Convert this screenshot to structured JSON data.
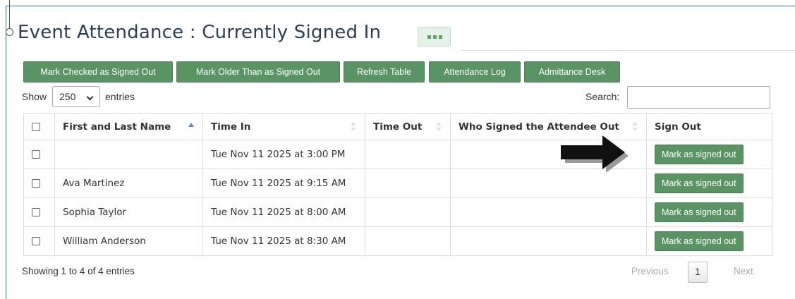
{
  "header": {
    "title": "Event Attendance : Currently Signed In"
  },
  "toolbar": {
    "buttons": [
      {
        "label": "Mark Checked as Signed Out"
      },
      {
        "label": "Mark Older Than as Signed Out"
      },
      {
        "label": "Refresh Table"
      },
      {
        "label": "Attendance Log"
      },
      {
        "label": "Admittance Desk"
      }
    ]
  },
  "length_control": {
    "show_label": "Show",
    "selected_value": "250",
    "entries_label": "entries"
  },
  "search": {
    "label": "Search:",
    "value": ""
  },
  "table": {
    "columns": [
      {
        "label": ""
      },
      {
        "label": "First and Last Name"
      },
      {
        "label": "Time In"
      },
      {
        "label": "Time Out"
      },
      {
        "label": "Who Signed the Attendee Out"
      },
      {
        "label": "Sign Out"
      }
    ],
    "rows": [
      {
        "name": "",
        "time_in": "Tue Nov 11 2025 at 3:00 PM",
        "time_out": "",
        "signed_out_by": "",
        "action": "Mark as signed out"
      },
      {
        "name": "Ava Martinez",
        "time_in": "Tue Nov 11 2025 at 9:15 AM",
        "time_out": "",
        "signed_out_by": "",
        "action": "Mark as signed out"
      },
      {
        "name": "Sophia Taylor",
        "time_in": "Tue Nov 11 2025 at 8:00 AM",
        "time_out": "",
        "signed_out_by": "",
        "action": "Mark as signed out"
      },
      {
        "name": "William Anderson",
        "time_in": "Tue Nov 11 2025 at 8:30 AM",
        "time_out": "",
        "signed_out_by": "",
        "action": "Mark as signed out"
      }
    ]
  },
  "footer": {
    "info": "Showing 1 to 4 of 4 entries",
    "previous": "Previous",
    "current_page": "1",
    "next": "Next"
  },
  "colors": {
    "button_green": "#5a9464",
    "title_text": "#2c3e50",
    "frame_border": "#3a6f93",
    "sort_active": "#6a82d6"
  }
}
